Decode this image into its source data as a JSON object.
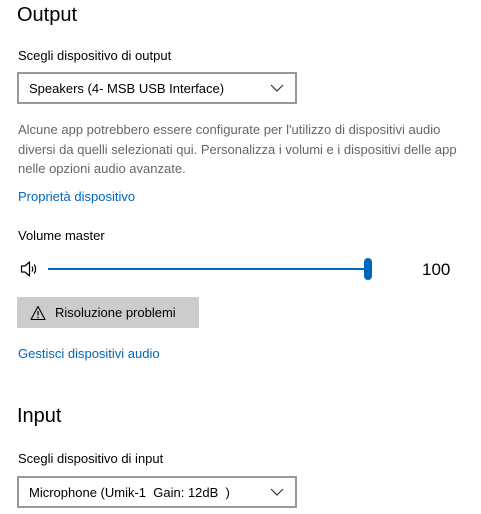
{
  "output": {
    "title": "Output",
    "device_label": "Scegli dispositivo di output",
    "device_value": "Speakers (4- MSB USB Interface)",
    "description": "Alcune app potrebbero essere configurate per l'utilizzo di dispositivi audio diversi da quelli selezionati qui. Personalizza i volumi e i dispositivi delle app nelle opzioni audio avanzate.",
    "properties_link": "Proprietà dispositivo",
    "volume_label": "Volume master",
    "volume_value": "100",
    "troubleshoot_label": "Risoluzione problemi",
    "manage_link": "Gestisci dispositivi audio"
  },
  "input": {
    "title": "Input",
    "device_label": "Scegli dispositivo di input",
    "device_value": "Microphone (Umik-1  Gain: 12dB  )"
  },
  "colors": {
    "accent": "#0067c0",
    "button_bg": "#cccccc",
    "secondary_text": "#666666",
    "dropdown_border": "#999999"
  },
  "icons": {
    "volume": "speaker-icon",
    "warning": "warning-icon",
    "dropdown": "chevron-down-icon"
  }
}
